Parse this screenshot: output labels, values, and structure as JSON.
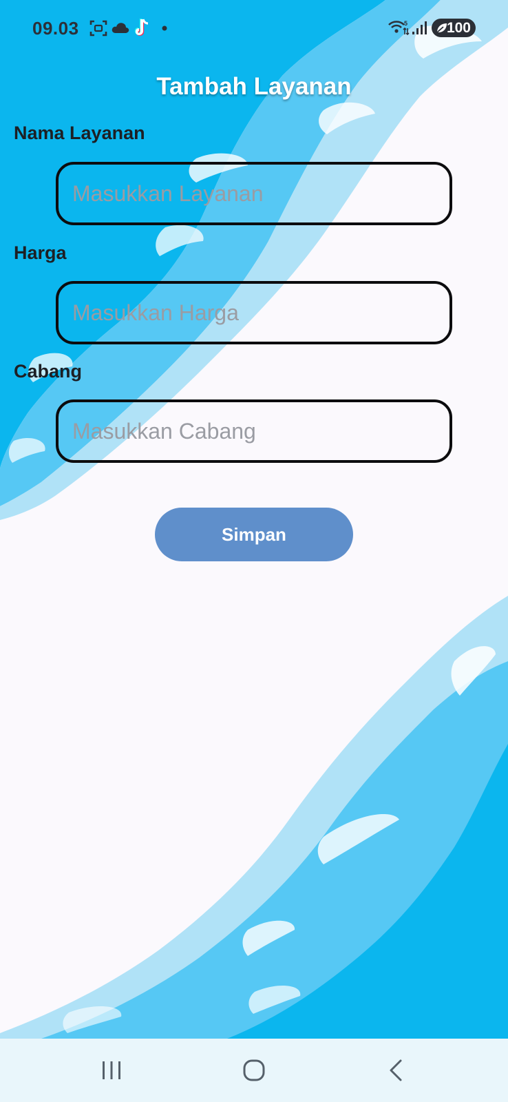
{
  "status_bar": {
    "time": "09.03",
    "battery_level": "100",
    "icons": [
      "screenshot-icon",
      "cloud-icon",
      "tiktok-icon",
      "notification-dot-icon",
      "wifi-icon",
      "signal-icon",
      "battery-saver-icon"
    ]
  },
  "header": {
    "title": "Tambah Layanan"
  },
  "form": {
    "fields": [
      {
        "label": "Nama Layanan",
        "placeholder": "Masukkan Layanan",
        "value": ""
      },
      {
        "label": "Harga",
        "placeholder": "Masukkan Harga",
        "value": ""
      },
      {
        "label": "Cabang",
        "placeholder": "Masukkan Cabang",
        "value": ""
      }
    ],
    "submit_label": "Simpan"
  },
  "nav_bar": {
    "buttons": [
      "recent-apps-icon",
      "home-icon",
      "back-icon"
    ]
  },
  "colors": {
    "background": "#fbf9fd",
    "water_dark": "#0bb6ee",
    "water_mid": "#56c8f4",
    "water_light": "#b0e2f7",
    "button": "#5f8fcb",
    "input_border": "#0c0c0e"
  }
}
